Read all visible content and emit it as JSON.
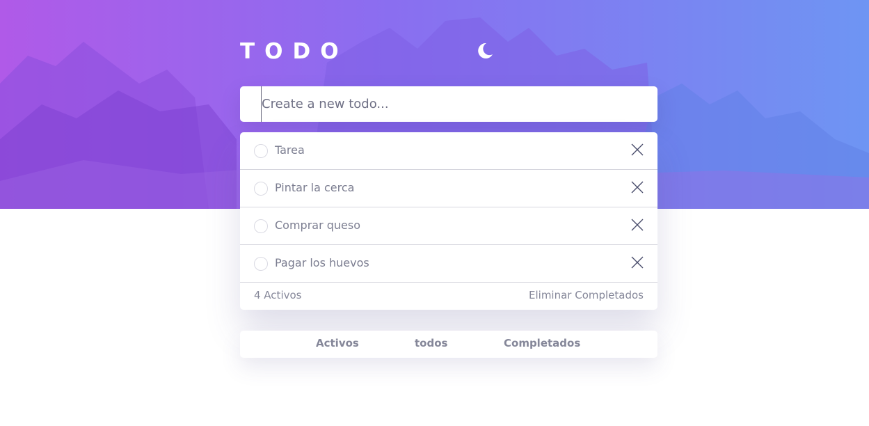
{
  "header": {
    "title": "TODO",
    "theme_toggle_icon": "moon-icon"
  },
  "new_todo": {
    "placeholder": "Create a new todo..."
  },
  "todos": [
    {
      "label": "Tarea",
      "completed": false
    },
    {
      "label": "Pintar la cerca",
      "completed": false
    },
    {
      "label": "Comprar queso",
      "completed": false
    },
    {
      "label": "Pagar los huevos",
      "completed": false
    }
  ],
  "footer": {
    "active_count": "4 Activos",
    "clear_label": "Eliminar Completados"
  },
  "filters": {
    "active": "Activos",
    "all": "todos",
    "completed": "Completados"
  },
  "colors": {
    "gradient_start": "#b05ae8",
    "gradient_end": "#6e95f3",
    "text": "#7b7d90"
  }
}
